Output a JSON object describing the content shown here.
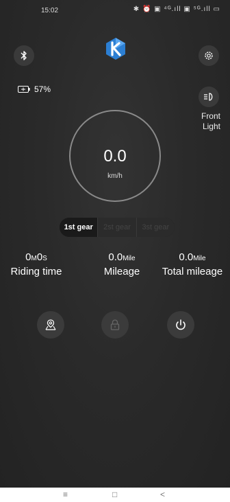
{
  "status": {
    "time": "15:02",
    "icons_text": "✱ ⏰ ▣ ⁴ᴳ.ıll ▣ ⁵ᴳ.ıll ▭"
  },
  "battery": {
    "percent": "57%"
  },
  "front_light": {
    "line1": "Front",
    "line2": "Light"
  },
  "speed": {
    "value": "0.0",
    "unit": "km/h"
  },
  "gears": [
    {
      "label": "1st gear",
      "active": true
    },
    {
      "label": "2st gear",
      "active": false
    },
    {
      "label": "3st gear",
      "active": false
    }
  ],
  "stats": {
    "riding_time": {
      "value_parts": [
        "0",
        "M",
        "0",
        "S"
      ],
      "label": "Riding time"
    },
    "mileage": {
      "value": "0.0",
      "unit": "Mile",
      "label": "Mileage"
    },
    "total_mileage": {
      "value": "0.0",
      "unit": "Mile",
      "label": "Total mileage"
    }
  },
  "navbar": {
    "menu": "≡",
    "home": "□",
    "back": "<"
  },
  "colors": {
    "background": "#262626",
    "button": "#3a3a3a",
    "ring": "#8a8a8a",
    "logo_blue": "#2c7fd3"
  }
}
